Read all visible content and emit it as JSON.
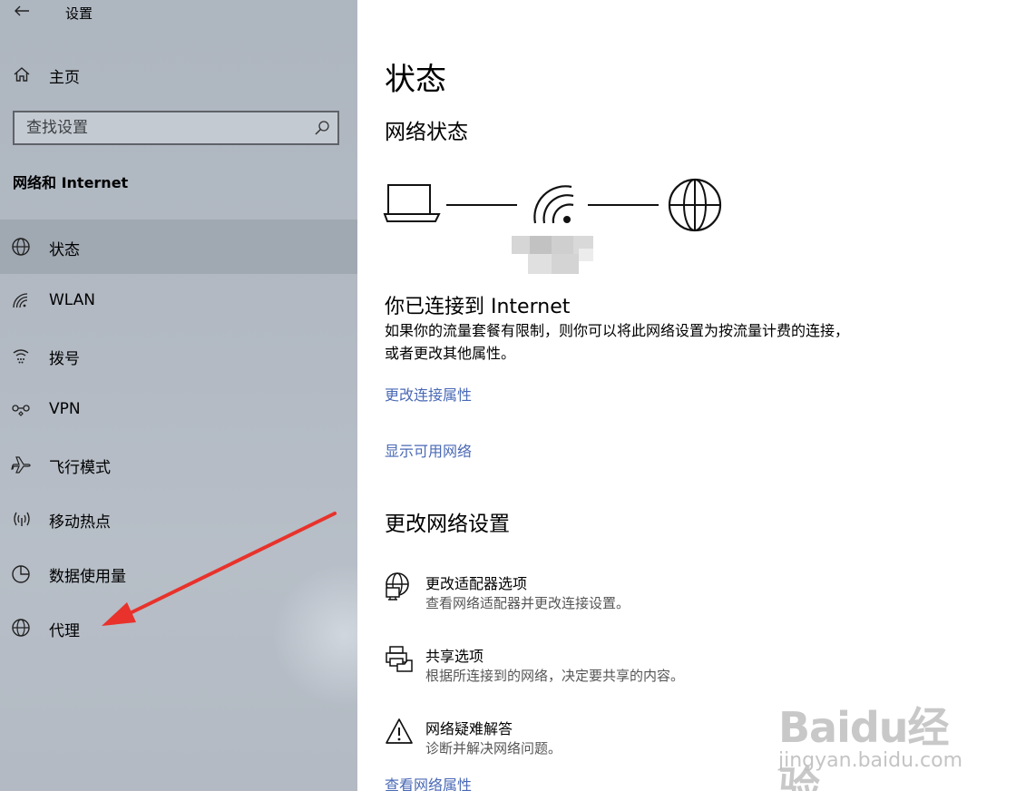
{
  "app": {
    "title": "设置"
  },
  "sidebar": {
    "home_label": "主页",
    "search_placeholder": "查找设置",
    "section_title": "网络和 Internet",
    "items": [
      {
        "label": "状态",
        "icon": "globe-status-icon",
        "active": true
      },
      {
        "label": "WLAN",
        "icon": "wifi-icon"
      },
      {
        "label": "拨号",
        "icon": "dialup-icon"
      },
      {
        "label": "VPN",
        "icon": "vpn-icon"
      },
      {
        "label": "飞行模式",
        "icon": "airplane-icon"
      },
      {
        "label": "移动热点",
        "icon": "hotspot-icon"
      },
      {
        "label": "数据使用量",
        "icon": "data-usage-icon"
      },
      {
        "label": "代理",
        "icon": "globe-icon"
      }
    ]
  },
  "main": {
    "title": "状态",
    "network_status_heading": "网络状态",
    "connected_title": "你已连接到 Internet",
    "connected_desc": "如果你的流量套餐有限制，则你可以将此网络设置为按流量计费的连接，或者更改其他属性。",
    "link_change_props": "更改连接属性",
    "link_show_networks": "显示可用网络",
    "change_settings_heading": "更改网络设置",
    "options": [
      {
        "title": "更改适配器选项",
        "subtitle": "查看网络适配器并更改连接设置。",
        "icon": "adapter-icon"
      },
      {
        "title": "共享选项",
        "subtitle": "根据所连接到的网络，决定要共享的内容。",
        "icon": "sharing-icon"
      },
      {
        "title": "网络疑难解答",
        "subtitle": "诊断并解决网络问题。",
        "icon": "warning-icon"
      }
    ],
    "link_view_props": "查看网络属性"
  },
  "watermark": {
    "brand": "Baidu经验",
    "url": "jingyan.baidu.com"
  },
  "colors": {
    "link": "#4a69b5",
    "sidebar_bg": "#b2b9c3",
    "arrow": "#e8322b"
  }
}
